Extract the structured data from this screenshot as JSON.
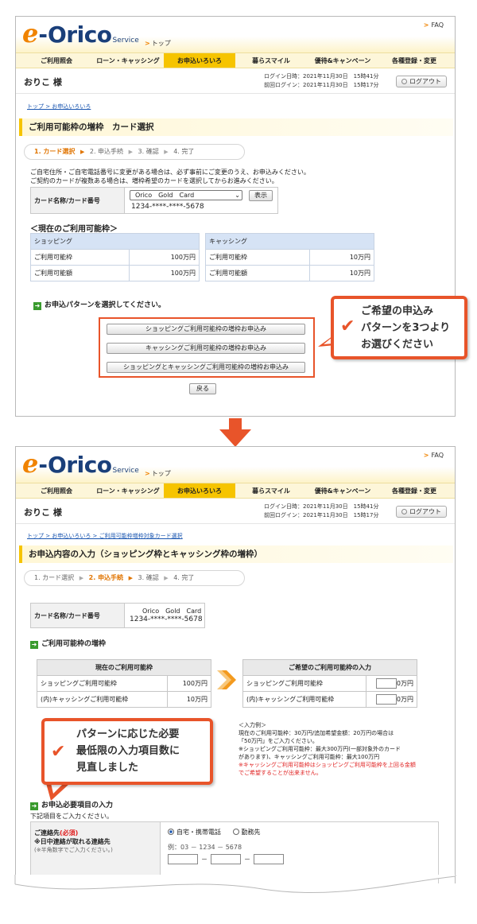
{
  "header": {
    "logo_e": "e",
    "logo_dash": "-",
    "logo_orico": "Orico",
    "logo_service": "Service",
    "top_link": "トップ",
    "faq": "FAQ"
  },
  "nav": [
    "ご利用照会",
    "ローン・キャッシング",
    "お申込いろいろ",
    "暮らスマイル",
    "優待&キャンペーン",
    "各種登録・変更"
  ],
  "user": {
    "name": "おりこ 様",
    "login_time": "ログイン日時：2021年11月30日　15時41分",
    "prev_login": "前回ログイン：2021年11月30日　15時17分",
    "logout": "ログアウト"
  },
  "screen1": {
    "breadcrumb": "トップ > お申込いろいろ",
    "title": "ご利用可能枠の増枠　カード選択",
    "steps": [
      "1. カード選択",
      "2. 申込手続",
      "3. 確認",
      "4. 完了"
    ],
    "notice1": "ご自宅住所・ご自宅電話番号に変更がある場合は、必ず事前にご変更のうえ、お申込みください。",
    "notice2": "ご契約のカードが複数ある場合は、増枠希望のカードを選択してからお進みください。",
    "card_label": "カード名称/カード番号",
    "card_select": "Orico　Gold　Card",
    "card_number": "1234-****-****-5678",
    "show_button": "表示",
    "limit_heading": "＜現在のご利用可能枠＞",
    "shopping": {
      "header": "ショッピング",
      "row1_label": "ご利用可能枠",
      "row1_value": "100万円",
      "row2_label": "ご利用可能額",
      "row2_value": "100万円"
    },
    "cashing": {
      "header": "キャッシング",
      "row1_label": "ご利用可能枠",
      "row1_value": "10万円",
      "row2_label": "ご利用可能額",
      "row2_value": "10万円"
    },
    "pattern_prompt": "お申込パターンを選択してください。",
    "pattern_buttons": [
      "ショッピングご利用可能枠の増枠お申込み",
      "キャッシングご利用可能枠の増枠お申込み",
      "ショッピングとキャッシングご利用可能枠の増枠お申込み"
    ],
    "back_button": "戻る",
    "callout": [
      "ご希望の申込み",
      "パターンを3つより",
      "お選びください"
    ]
  },
  "screen2": {
    "breadcrumb": "トップ > お申込いろいろ > ご利用可能枠増枠対象カード選択",
    "title": "お申込内容の入力（ショッピング枠とキャッシング枠の増枠）",
    "steps": [
      "1. カード選択",
      "2. 申込手続",
      "3. 確認",
      "4. 完了"
    ],
    "card_label": "カード名称/カード番号",
    "card_name": "Orico　Gold　Card",
    "card_number": "1234-****-****-5678",
    "increase_heading": "ご利用可能枠の増枠",
    "current": {
      "header": "現在のご利用可能枠",
      "row1_label": "ショッピングご利用可能枠",
      "row1_value": "100万円",
      "row2_label": "(内)キャッシングご利用可能枠",
      "row2_value": "10万円"
    },
    "desired": {
      "header": "ご希望のご利用可能枠の入力",
      "row1_label": "ショッピングご利用可能枠",
      "row1_unit": "0万円",
      "row2_label": "(内)キャッシングご利用可能枠",
      "row2_unit": "0万円"
    },
    "example": [
      "＜入力例＞",
      "現在のご利用可能枠：30万円/追加希望金額：20万円の場合は",
      "「50万円」をご入力ください。",
      "※ショッピングご利用可能枠：最大300万円(一部対象外のカード",
      "があります)、キャッシングご利用可能枠：最大100万円"
    ],
    "example_red": [
      "※キャッシングご利用可能枠はショッピングご利用可能枠を上回る金額",
      "でご希望することが出来ません。"
    ],
    "callout": [
      "パターンに応じた必要",
      "最低限の入力項目数に",
      "見直しました"
    ],
    "required_heading": "お申込必要項目の入力",
    "required_note": "下記項目をご入力ください。",
    "contact_label": "ご連絡先",
    "contact_required": "(必須)",
    "contact_sub": "※日中連絡が取れる連絡先",
    "contact_hint": "(※半角数字でご入力ください。)",
    "radio_home": "自宅・携帯電話",
    "radio_work": "勤務先",
    "example_phone": "例：03 － 1234 － 5678",
    "dash": "－"
  }
}
